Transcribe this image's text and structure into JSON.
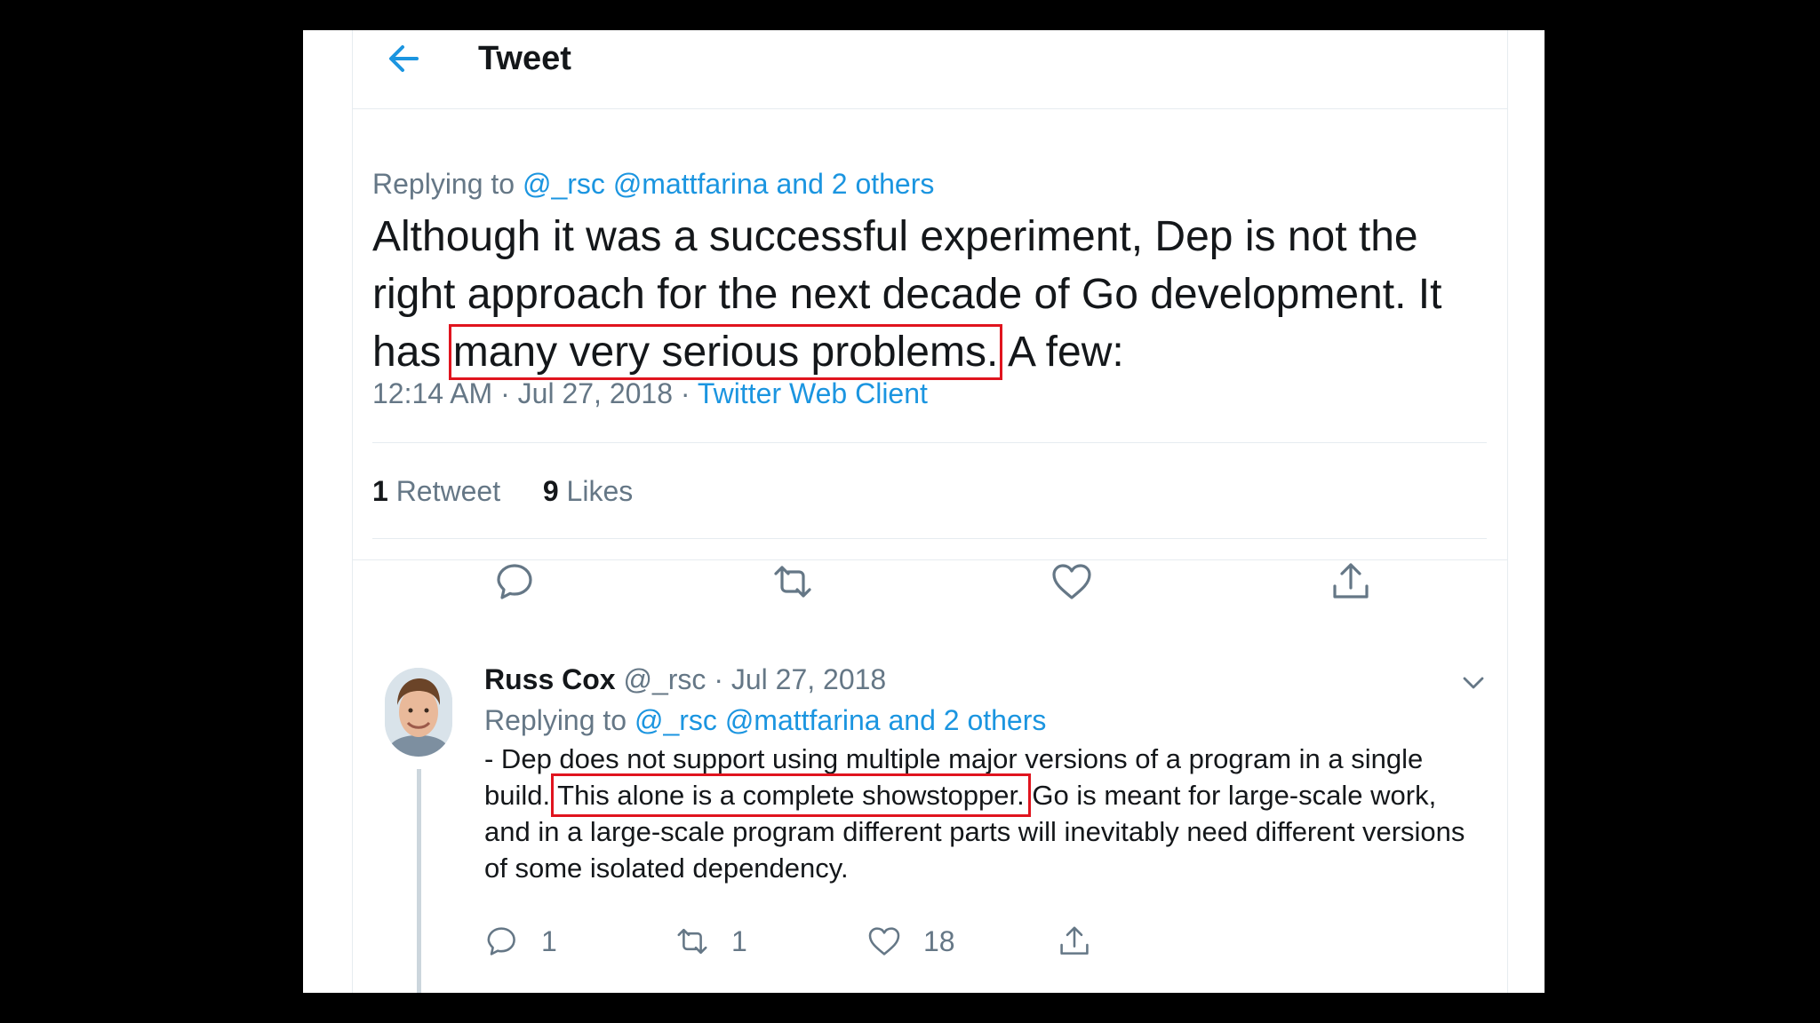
{
  "header": {
    "title": "Tweet"
  },
  "tweet": {
    "replying_to_label": "Replying to",
    "replying_to_users": "@_rsc @mattfarina and 2 others",
    "text_before": "Although it was a successful experiment, Dep is not the right approach for the next decade of Go development. It has ",
    "text_highlight": "many very serious problems.",
    "text_after": " A few:",
    "timestamp": "12:14 AM · Jul 27, 2018 · ",
    "client": "Twitter Web Client",
    "retweet_count": "1",
    "retweet_label": "Retweet",
    "like_count": "9",
    "like_label": "Likes"
  },
  "reply": {
    "name": "Russ Cox",
    "handle_date": " @_rsc · Jul 27, 2018",
    "replying_to_label": "Replying to",
    "replying_to_users": "@_rsc @mattfarina and 2 others",
    "text_before": "- Dep does not support using multiple major versions of a program in a single build. ",
    "text_highlight": "This alone is a complete showstopper.",
    "text_after": " Go is meant for large-scale work, and in a large-scale program different parts will inevitably need different versions of some isolated dependency.",
    "reply_count": "1",
    "retweet_count": "1",
    "like_count": "18"
  },
  "icons": [
    "back-arrow-icon",
    "reply-icon",
    "retweet-icon",
    "like-icon",
    "share-icon",
    "chevron-down-icon"
  ],
  "colors": {
    "accent": "#1b95e0",
    "text": "#14171a",
    "muted": "#657786",
    "highlight": "#e0141e",
    "divider": "#e6ecf0"
  }
}
